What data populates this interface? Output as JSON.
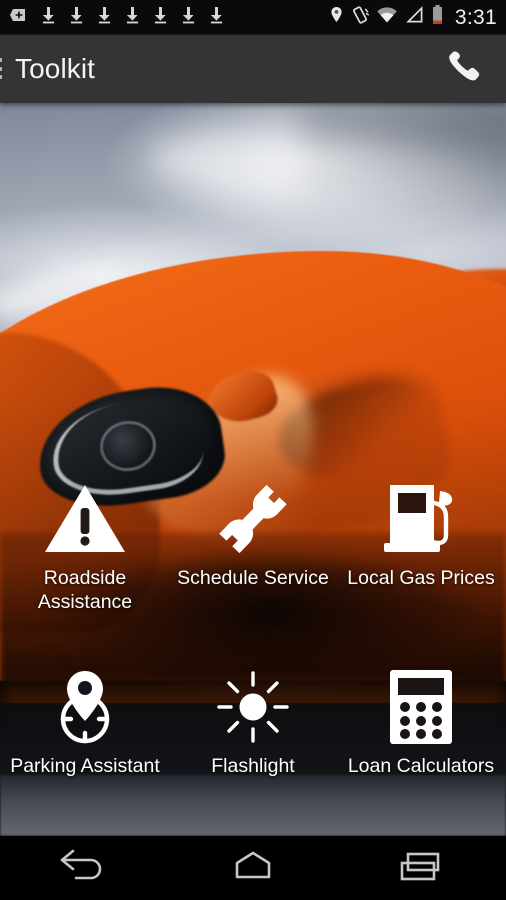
{
  "status_bar": {
    "notification_icons": [
      {
        "name": "sd-card-icon"
      },
      {
        "name": "download-icon"
      },
      {
        "name": "download-icon"
      },
      {
        "name": "download-icon"
      },
      {
        "name": "download-icon"
      },
      {
        "name": "download-icon"
      },
      {
        "name": "download-icon"
      },
      {
        "name": "download-icon"
      }
    ],
    "system_icons": [
      {
        "name": "location-pin-icon"
      },
      {
        "name": "vibrate-icon"
      },
      {
        "name": "wifi-icon"
      },
      {
        "name": "cell-signal-icon"
      },
      {
        "name": "battery-low-icon"
      }
    ],
    "time": "3:31",
    "background_color": "#0a0a0a",
    "battery_warning_color": "#d03a1e"
  },
  "action_bar": {
    "drawer_icon": "hamburger-menu-icon",
    "title": "Toolkit",
    "call_icon": "phone-icon",
    "background_color": "#343434",
    "title_color": "#f4f4f4"
  },
  "grid": {
    "tiles": [
      {
        "icon": "warning-triangle-icon",
        "label": "Roadside Assistance"
      },
      {
        "icon": "wrench-icon",
        "label": "Schedule Service"
      },
      {
        "icon": "gas-pump-icon",
        "label": "Local Gas Prices"
      },
      {
        "icon": "parking-pin-target-icon",
        "label": "Parking Assistant"
      },
      {
        "icon": "sun-brightness-icon",
        "label": "Flashlight"
      },
      {
        "icon": "calculator-icon",
        "label": "Loan Calculators"
      }
    ],
    "icon_color": "#ffffff",
    "label_color": "#ffffff"
  },
  "background": {
    "description": "Orange sports car front three-quarter view under cloudy sky",
    "car_color": "#e8560f",
    "sky_color": "#98a0ae"
  },
  "nav_bar": {
    "buttons": [
      {
        "name": "back-button",
        "icon": "back-arrow-icon"
      },
      {
        "name": "home-button",
        "icon": "home-icon"
      },
      {
        "name": "recents-button",
        "icon": "recents-icon"
      }
    ],
    "background_color": "#000000"
  }
}
